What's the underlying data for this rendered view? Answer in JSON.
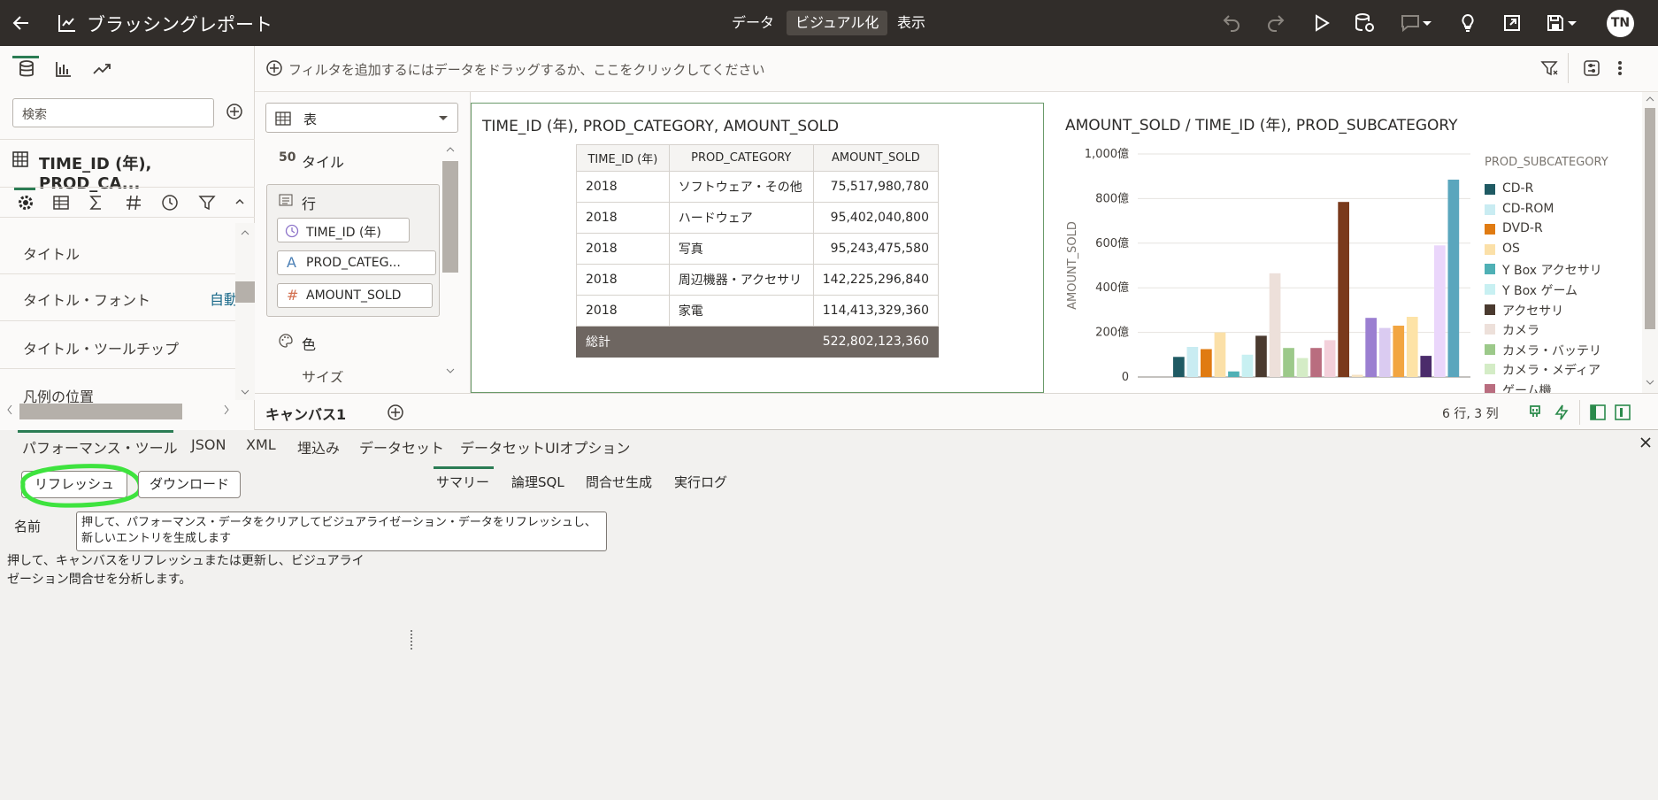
{
  "app": {
    "title": "ブラッシングレポート",
    "user_initials": "TN"
  },
  "nav": {
    "tabs": [
      "データ",
      "ビジュアル化",
      "表示"
    ],
    "active": "ビジュアル化"
  },
  "filter_bar": {
    "placeholder": "フィルタを追加するにはデータをドラッグするか、ここをクリックしてください"
  },
  "left_panel": {
    "search_placeholder": "検索",
    "viz_title": "TIME_ID (年), PROD_CA...",
    "properties": [
      {
        "label": "タイトル",
        "value": ""
      },
      {
        "label": "タイトル・フォント",
        "value": "自動"
      },
      {
        "label": "タイトル・ツールチップ",
        "value": ""
      },
      {
        "label": "凡例の位置",
        "value": ""
      }
    ]
  },
  "grammar": {
    "viz_type": "表",
    "sections": {
      "tile": "タイル",
      "rows": "行",
      "color": "色",
      "size": "サイズ"
    },
    "row_pills": [
      "TIME_ID (年)",
      "PROD_CATEG...",
      "AMOUNT_SOLD"
    ],
    "tile_glyph": "50"
  },
  "table_viz": {
    "title": "TIME_ID (年), PROD_CATEGORY, AMOUNT_SOLD",
    "columns": [
      "TIME_ID (年)",
      "PROD_CATEGORY",
      "AMOUNT_SOLD"
    ],
    "rows": [
      [
        "2018",
        "ソフトウェア・その他",
        "75,517,980,780"
      ],
      [
        "2018",
        "ハードウェア",
        "95,402,040,800"
      ],
      [
        "2018",
        "写真",
        "95,243,475,580"
      ],
      [
        "2018",
        "周辺機器・アクセサリ",
        "142,225,296,840"
      ],
      [
        "2018",
        "家電",
        "114,413,329,360"
      ]
    ],
    "total_label": "総計",
    "total_value": "522,802,123,360"
  },
  "chart_data": {
    "type": "bar",
    "title": "AMOUNT_SOLD / TIME_ID (年), PROD_SUBCATEGORY",
    "ylabel": "AMOUNT_SOLD",
    "ylim": [
      0,
      1000
    ],
    "yticks": [
      "0",
      "200億",
      "400億",
      "600億",
      "800億",
      "1,000億"
    ],
    "legend_title": "PROD_SUBCATEGORY",
    "series": [
      {
        "name": "CD-R",
        "value": 90,
        "color": "#1f5a63"
      },
      {
        "name": "CD-ROM",
        "value": 135,
        "color": "#c9ecf2"
      },
      {
        "name": "DVD-R",
        "value": 125,
        "color": "#e07b12"
      },
      {
        "name": "OS",
        "value": 200,
        "color": "#fbe0a8"
      },
      {
        "name": "Y Box アクセサリ",
        "value": 25,
        "color": "#4fb0b5"
      },
      {
        "name": "Y Box ゲーム",
        "value": 100,
        "color": "#c8f0f2"
      },
      {
        "name": "アクセサリ",
        "value": 185,
        "color": "#4a3a2f"
      },
      {
        "name": "カメラ",
        "value": 465,
        "color": "#ede0da"
      },
      {
        "name": "カメラ・バッテリ",
        "value": 130,
        "color": "#9cc98a"
      },
      {
        "name": "カメラ・メディア",
        "value": 85,
        "color": "#d4ecc6"
      },
      {
        "name": "ゲーム機",
        "value": 130,
        "color": "#b96d7f"
      },
      {
        "name": "",
        "value": 165,
        "color": "#f3d0da"
      },
      {
        "name": "",
        "value": 785,
        "color": "#7a3a1c"
      },
      {
        "name": "",
        "value": 10,
        "color": "#f5e1c0"
      },
      {
        "name": "",
        "value": 265,
        "color": "#9b7fd1"
      },
      {
        "name": "",
        "value": 220,
        "color": "#dacbf1"
      },
      {
        "name": "",
        "value": 230,
        "color": "#f2a541"
      },
      {
        "name": "",
        "value": 270,
        "color": "#fde3a7"
      },
      {
        "name": "",
        "value": 95,
        "color": "#4b2c6b"
      },
      {
        "name": "",
        "value": 590,
        "color": "#ead6fb"
      },
      {
        "name": "",
        "value": 885,
        "color": "#5aa6bd"
      }
    ]
  },
  "status": {
    "canvas_tab": "キャンバス1",
    "dimensions": "6 行, 3 列"
  },
  "perf": {
    "tabs": [
      "パフォーマンス・ツール",
      "JSON",
      "XML",
      "埋込み",
      "データセット",
      "データセットUIオプション"
    ],
    "refresh_label": "リフレッシュ",
    "download_label": "ダウンロード",
    "subtabs": [
      "サマリー",
      "論理SQL",
      "問合せ生成",
      "実行ログ"
    ],
    "name_header": "名前",
    "tooltip": "押して、パフォーマンス・データをクリアしてビジュアライゼーション・データをリフレッシュし、新しいエントリを生成します",
    "description": "押して、キャンバスをリフレッシュまたは更新し、ビジュアライゼーション問合せを分析します。",
    "description_line1": "押して、キャンバスをリフレッシュまたは更新し、ビジュアライ",
    "description_line2": "ゼーション問合せを分析します。"
  }
}
